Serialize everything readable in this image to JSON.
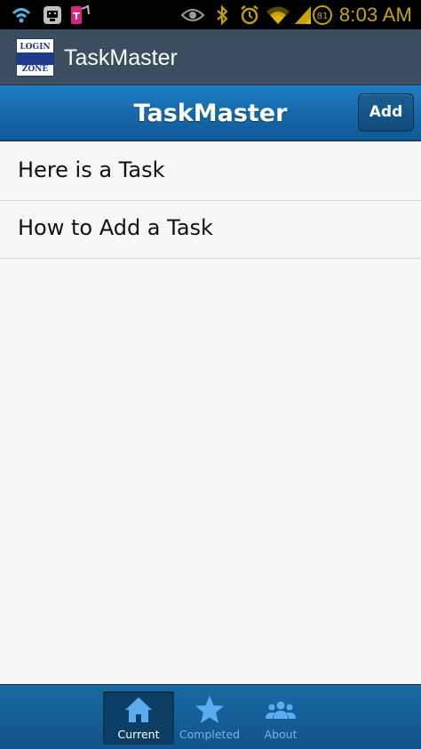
{
  "status_bar": {
    "time": "8:03 AM",
    "battery_level": "81",
    "icons": [
      "wifi-calling-icon",
      "notification-icon",
      "t-mobile-icon",
      "eye-icon",
      "bluetooth-icon",
      "alarm-icon",
      "wifi-icon",
      "signal-icon",
      "battery-icon"
    ]
  },
  "app_bar": {
    "title": "TaskMaster",
    "logo_lines": [
      "LOGIN",
      "ZONE"
    ]
  },
  "header": {
    "title": "TaskMaster",
    "add_label": "Add"
  },
  "tasks": [
    {
      "label": "Here is a Task"
    },
    {
      "label": "How to Add a Task"
    }
  ],
  "footer": {
    "tabs": [
      {
        "label": "Current",
        "icon": "home-icon",
        "active": true
      },
      {
        "label": "Completed",
        "icon": "star-icon",
        "active": false
      },
      {
        "label": "About",
        "icon": "people-icon",
        "active": false
      }
    ]
  },
  "colors": {
    "header_blue": "#1566a6",
    "app_bar": "#3b4e61",
    "status_time": "#c9a400",
    "icon_blue": "#5aaef0"
  }
}
